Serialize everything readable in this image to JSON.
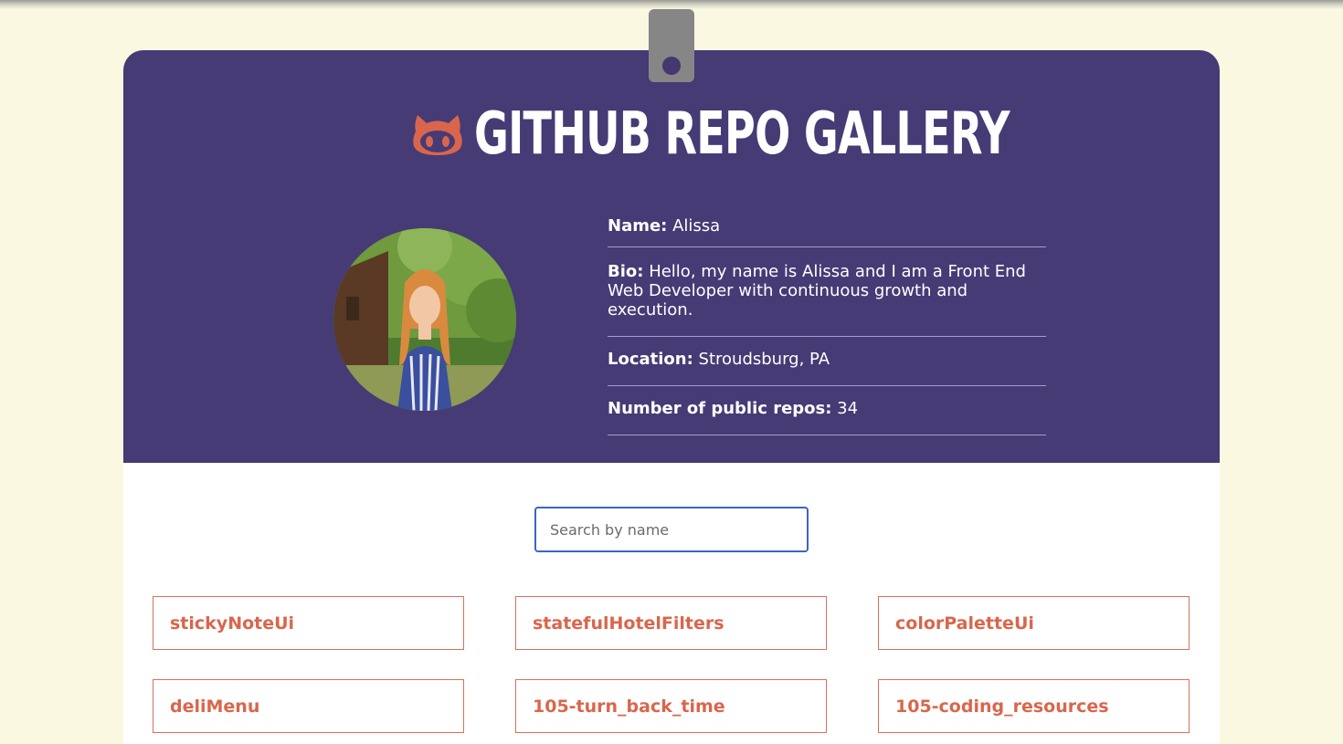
{
  "app": {
    "title": "GITHUB REPO GALLERY"
  },
  "icons": {
    "logo": "octocat-icon"
  },
  "colors": {
    "background": "#faf8e1",
    "header": "#463b75",
    "accent": "#d9664c",
    "search_border": "#3d63c4",
    "clip": "#868686"
  },
  "profile": {
    "avatar_alt": "avatar",
    "name_label": "Name:",
    "name_value": " Alissa",
    "bio_label": "Bio:",
    "bio_value": " Hello, my name is Alissa and I am a Front End Web Developer with continuous growth and execution.",
    "location_label": "Location:",
    "location_value": " Stroudsburg, PA",
    "repos_label": "Number of public repos:",
    "repos_value": " 34"
  },
  "search": {
    "placeholder": "Search by name",
    "value": ""
  },
  "repos": [
    "stickyNoteUi",
    "statefulHotelFilters",
    "colorPaletteUi",
    "deliMenu",
    "105-turn_back_time",
    "105-coding_resources"
  ]
}
